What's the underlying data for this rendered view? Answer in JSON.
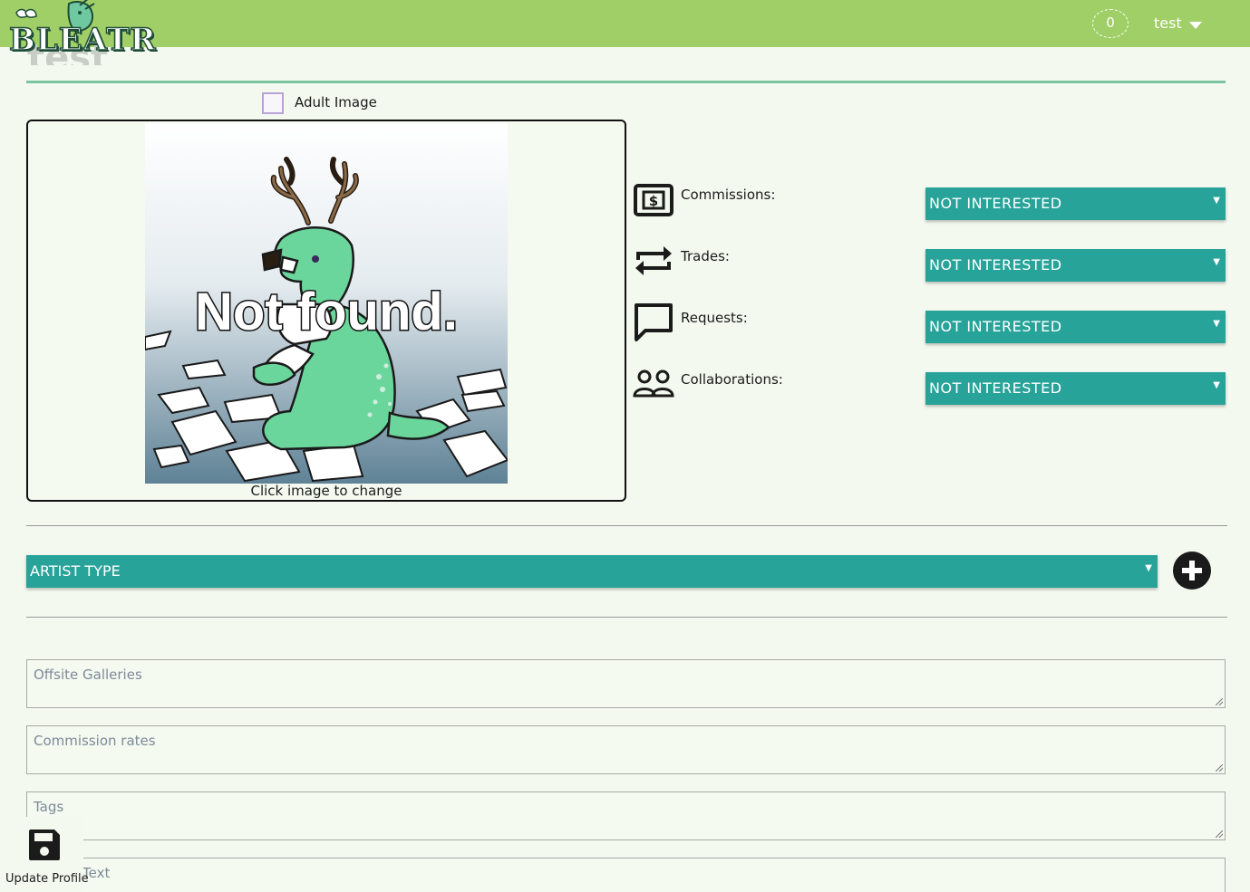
{
  "header": {
    "logo_text": "BLEATR",
    "notification_count": "0",
    "username": "test"
  },
  "page": {
    "title": "test"
  },
  "image": {
    "adult_label": "Adult Image",
    "placeholder_text": "Not found.",
    "caption": "Click image to change"
  },
  "options": [
    {
      "label": "Commissions:",
      "icon": "dollar-card-icon",
      "value": "NOT INTERESTED"
    },
    {
      "label": "Trades:",
      "icon": "repeat-arrows-icon",
      "value": "NOT INTERESTED"
    },
    {
      "label": "Requests:",
      "icon": "speech-bubble-icon",
      "value": "NOT INTERESTED"
    },
    {
      "label": "Collaborations:",
      "icon": "people-icon",
      "value": "NOT INTERESTED"
    }
  ],
  "artist_type": {
    "value": "ARTIST TYPE"
  },
  "fields": [
    {
      "placeholder": "Offsite Galleries"
    },
    {
      "placeholder": "Commission rates"
    },
    {
      "placeholder": "Tags"
    },
    {
      "placeholder": "Text"
    }
  ],
  "save": {
    "label": "Update Profile"
  },
  "colors": {
    "header": "#a0cf68",
    "select": "#27a39a",
    "background": "#f3f9ef"
  }
}
